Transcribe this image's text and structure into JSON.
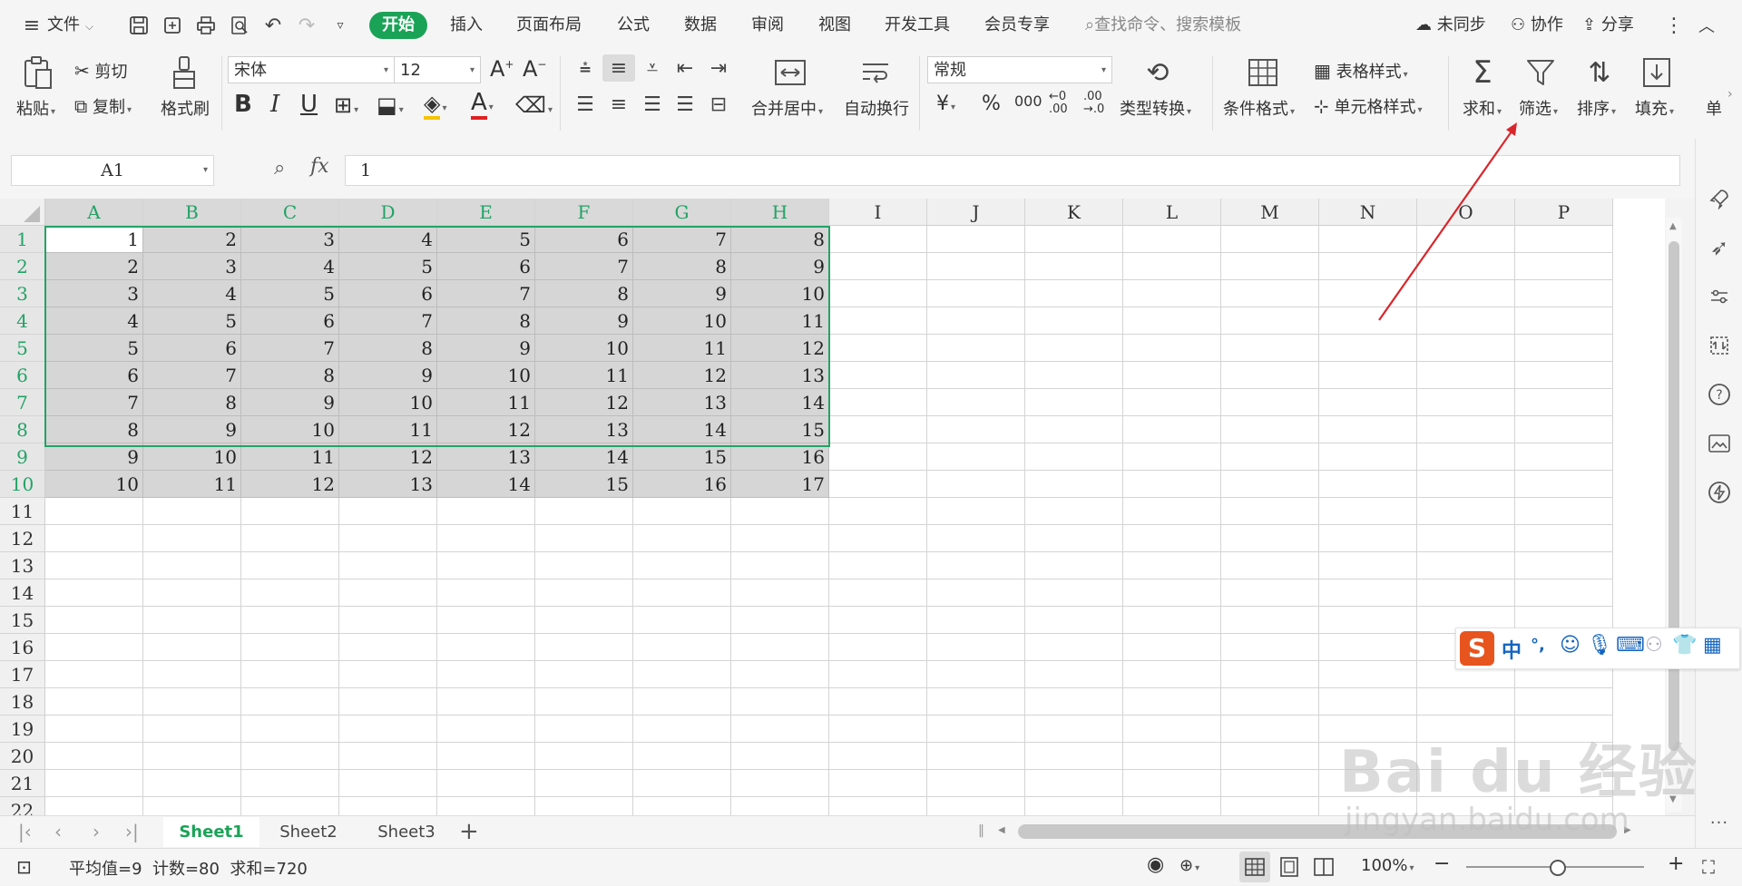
{
  "menubar": {
    "file_label": "文件",
    "tabs": [
      "开始",
      "插入",
      "页面布局",
      "公式",
      "数据",
      "审阅",
      "视图",
      "开发工具",
      "会员专享"
    ],
    "search_placeholder": "查找命令、搜索模板",
    "sync_label": "未同步",
    "collab_label": "协作",
    "share_label": "分享"
  },
  "ribbon": {
    "paste": "粘贴",
    "cut": "剪切",
    "copy": "复制",
    "format_painter": "格式刷",
    "font_name": "宋体",
    "font_size": "12",
    "merge_center": "合并居中",
    "wrap_text": "自动换行",
    "number_format": "常规",
    "type_convert": "类型转换",
    "cond_format": "条件格式",
    "table_style": "表格样式",
    "cell_style": "单元格样式",
    "sum": "求和",
    "filter": "筛选",
    "sort": "排序",
    "fill": "填充",
    "more": "单"
  },
  "formula_bar": {
    "name_box": "A1",
    "fx_label": "fx",
    "content": "1"
  },
  "grid": {
    "columns": [
      "A",
      "B",
      "C",
      "D",
      "E",
      "F",
      "G",
      "H",
      "I",
      "J",
      "K",
      "L",
      "M",
      "N",
      "O",
      "P"
    ],
    "rows": [
      "1",
      "2",
      "3",
      "4",
      "5",
      "6",
      "7",
      "8",
      "9",
      "10",
      "11",
      "12",
      "13",
      "14",
      "15",
      "16",
      "17",
      "18",
      "19",
      "20",
      "21",
      "22"
    ],
    "data": [
      [
        "1",
        "2",
        "3",
        "4",
        "5",
        "6",
        "7",
        "8"
      ],
      [
        "2",
        "3",
        "4",
        "5",
        "6",
        "7",
        "8",
        "9"
      ],
      [
        "3",
        "4",
        "5",
        "6",
        "7",
        "8",
        "9",
        "10"
      ],
      [
        "4",
        "5",
        "6",
        "7",
        "8",
        "9",
        "10",
        "11"
      ],
      [
        "5",
        "6",
        "7",
        "8",
        "9",
        "10",
        "11",
        "12"
      ],
      [
        "6",
        "7",
        "8",
        "9",
        "10",
        "11",
        "12",
        "13"
      ],
      [
        "7",
        "8",
        "9",
        "10",
        "11",
        "12",
        "13",
        "14"
      ],
      [
        "8",
        "9",
        "10",
        "11",
        "12",
        "13",
        "14",
        "15"
      ],
      [
        "9",
        "10",
        "11",
        "12",
        "13",
        "14",
        "15",
        "16"
      ],
      [
        "10",
        "11",
        "12",
        "13",
        "14",
        "15",
        "16",
        "17"
      ]
    ]
  },
  "sheets": [
    "Sheet1",
    "Sheet2",
    "Sheet3"
  ],
  "status": {
    "summary": "平均值=9  计数=80  求和=720",
    "zoom": "100%"
  },
  "ime": {
    "mode": "中",
    "punct": "°,"
  },
  "watermark": {
    "brand": "Bai du 经验",
    "url": "jingyan.baidu.com"
  },
  "colors": {
    "accent": "#1aa357",
    "selection_border": "#21a366",
    "selection_fill": "#d6d6d6",
    "arrow": "#d9262c"
  }
}
